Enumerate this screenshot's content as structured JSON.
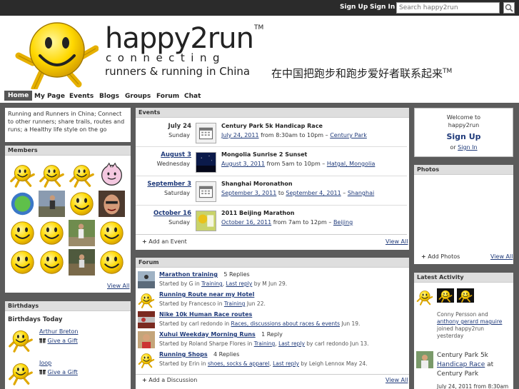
{
  "topbar": {
    "signup": "Sign Up",
    "signin": "Sign In",
    "search_placeholder": "Search happy2run"
  },
  "brand": {
    "name": "happy2run",
    "tm": "TM",
    "connecting": "connecting",
    "tagline": "runners & running in China",
    "chinese": "在中国把跑步和跑步爱好者联系起来",
    "chinese_tm": "TM"
  },
  "nav": [
    "Home",
    "My Page",
    "Events",
    "Blogs",
    "Groups",
    "Forum",
    "Chat"
  ],
  "intro": "Running and Runners in China; Connect to other runners; share trails, routes and runs; a Healthy life style on the go",
  "members": {
    "title": "Members",
    "view_all": "View All"
  },
  "birthdays": {
    "title": "Birthdays",
    "heading": "Birthdays Today",
    "people": [
      {
        "name": "Arthur Breton",
        "gift": "Give a Gift"
      },
      {
        "name": "Joop",
        "gift": "Give a Gift"
      }
    ]
  },
  "events": {
    "title": "Events",
    "items": [
      {
        "date": "July 24",
        "day": "Sunday",
        "title": "Century Park 5k Handicap Race",
        "when_link": "July 24, 2011",
        "when_rest": "from 8:30am to 10pm –",
        "place": "Century Park"
      },
      {
        "date": "August 3",
        "day": "Wednesday",
        "title": "Mongolia Sunrise 2 Sunset",
        "when_link": "August 3, 2011",
        "when_rest": "from 5am to 10pm –",
        "place": "Hatgal, Mongolia"
      },
      {
        "date": "September 3",
        "day": "Saturday",
        "title": "Shanghai Moronathon",
        "when_link": "September 3, 2011",
        "when_mid": "to",
        "when_link2": "September 4, 2011",
        "when_rest": "–",
        "place": "Shanghai"
      },
      {
        "date": "October 16",
        "day": "Sunday",
        "title": "2011 Beijing Marathon",
        "when_link": "October 16, 2011",
        "when_rest": "from 7am to 12pm –",
        "place": "Beijing"
      }
    ],
    "add": "Add an Event",
    "view_all": "View All"
  },
  "forum": {
    "title": "Forum",
    "items": [
      {
        "title": "Marathon training",
        "replies": "5 Replies",
        "started": "Started by G in",
        "cat": "Training",
        "last": "Last reply",
        "tail": "by M Jun 29."
      },
      {
        "title": "Running Route near my Hotel",
        "replies": "",
        "started": "Started by Francesco in",
        "cat": "Training",
        "last": "",
        "tail": "Jun 22."
      },
      {
        "title": "Nike 10k Human Race routes",
        "replies": "",
        "started": "Started by carl redondo in",
        "cat": "Races, discussions about races & events",
        "last": "",
        "tail": "Jun 19."
      },
      {
        "title": "Xuhui Weekday Morning Runs",
        "replies": "1 Reply",
        "started": "Started by Roland Sharpe Flores in",
        "cat": "Training",
        "last": "Last reply",
        "tail": "by carl redondo Jun 13."
      },
      {
        "title": "Running Shops",
        "replies": "4 Replies",
        "started": "Started by Erin in",
        "cat": "shoes, socks & apparel",
        "last": "Last reply",
        "tail": "by Leigh Lennox May 24."
      }
    ],
    "add": "Add a Discussion",
    "view_all": "View All"
  },
  "welcome": {
    "line1": "Welcome to",
    "line2": "happy2run",
    "signup": "Sign Up",
    "or": "or",
    "signin": "Sign In"
  },
  "photos": {
    "title": "Photos",
    "add": "Add Photos",
    "view_all": "View All"
  },
  "activity": {
    "title": "Latest Activity",
    "user1": "Conny Persson",
    "and": "and",
    "user2": "anthony gerard maguire",
    "joined": "joined",
    "site": "happy2run",
    "time": "yesterday",
    "event_title_a": "Century Park 5k",
    "event_title_b": "Handicap Race",
    "event_at": "at",
    "event_place": "Century Park",
    "event_date": "July 24, 2011 from 8:30am"
  },
  "colors": {
    "accent": "#1f3a7a",
    "topbar": "#2b2b2b",
    "page_bg": "#5b5b5b",
    "head_bg": "#dedede"
  }
}
